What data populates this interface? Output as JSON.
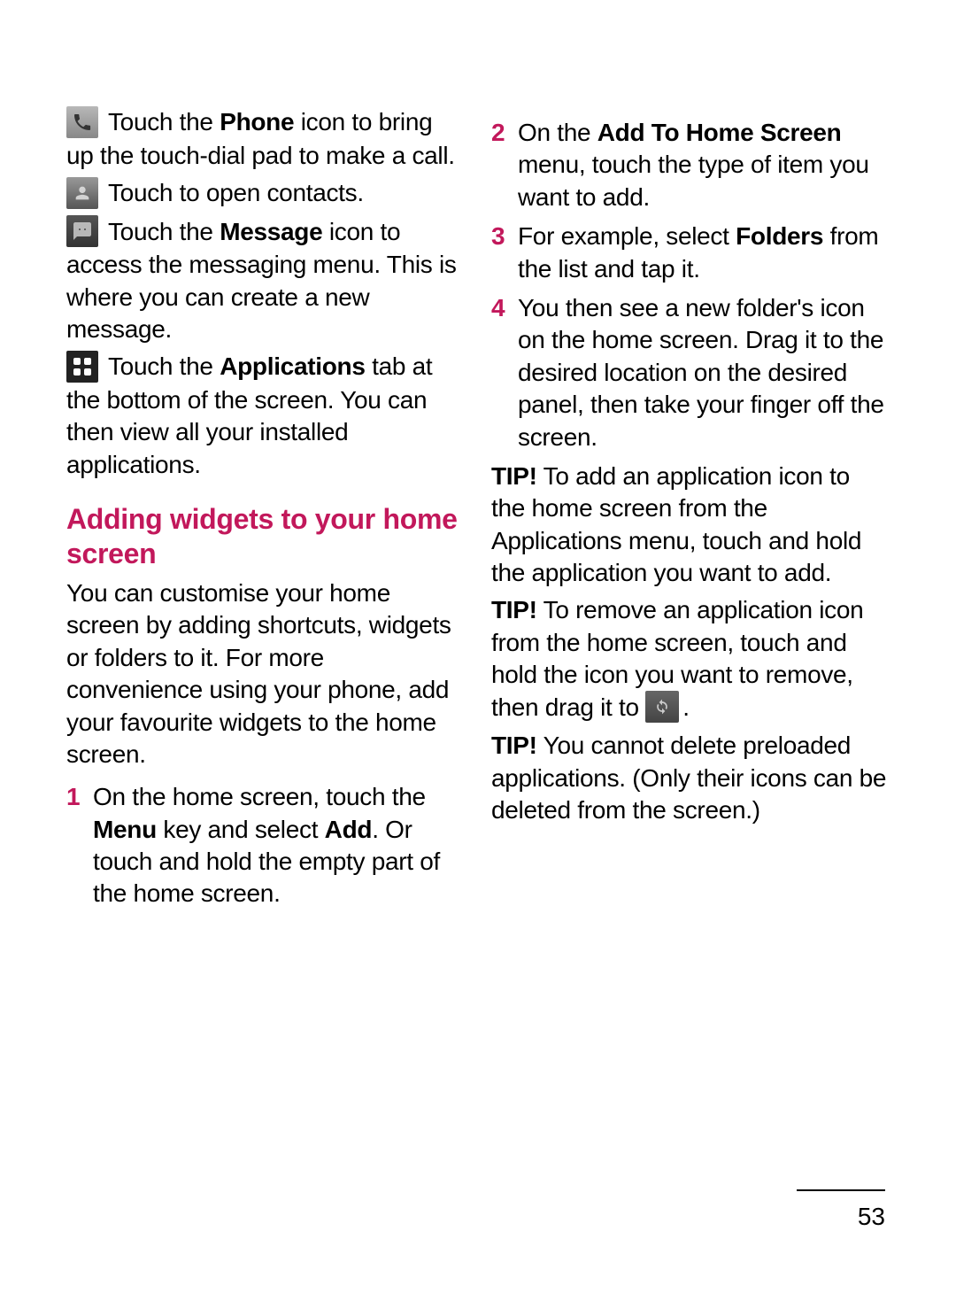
{
  "page_number": "53",
  "heading": "Adding widgets to your home screen",
  "left": {
    "phone_pre": " Touch the ",
    "phone_bold": "Phone",
    "phone_post": " icon to bring up the touch-dial pad to make a call.",
    "contacts": " Touch to open contacts.",
    "message_pre": " Touch the ",
    "message_bold": "Message",
    "message_post": " icon to access the messaging menu. This is where you can create a new message.",
    "apps_pre": " Touch the ",
    "apps_bold": "Applications",
    "apps_post": " tab at the bottom of the screen. You can then view all your installed applications.",
    "intro": "You can customise your home screen by adding shortcuts, widgets or folders to it. For more convenience using your phone, add your favourite widgets to the home screen.",
    "step1_a": "On the home screen, touch the ",
    "step1_b1": "Menu",
    "step1_mid": " key and select ",
    "step1_b2": "Add",
    "step1_c": ". Or touch and hold the empty part of the home screen."
  },
  "right": {
    "step2_a": "On the ",
    "step2_b": "Add To Home Screen",
    "step2_c": " menu, touch the type of item you want to add.",
    "step3_a": "For example, select ",
    "step3_b": "Folders",
    "step3_c": " from the list and tap it.",
    "step4": "You then see a new folder's icon on the home screen. Drag it to the desired location on the desired panel, then take your finger off the screen.",
    "tip1_label": "TIP!",
    "tip1": " To add an application icon to the home screen from the Applications menu, touch and hold the application you want to add.",
    "tip2_label": "TIP!",
    "tip2_a": " To remove an application icon from the home screen, touch and hold the icon you want to remove, then drag it to ",
    "tip2_b": ".",
    "tip3_label": "TIP!",
    "tip3": " You cannot delete preloaded applications. (Only their icons can be deleted from the screen.)"
  }
}
